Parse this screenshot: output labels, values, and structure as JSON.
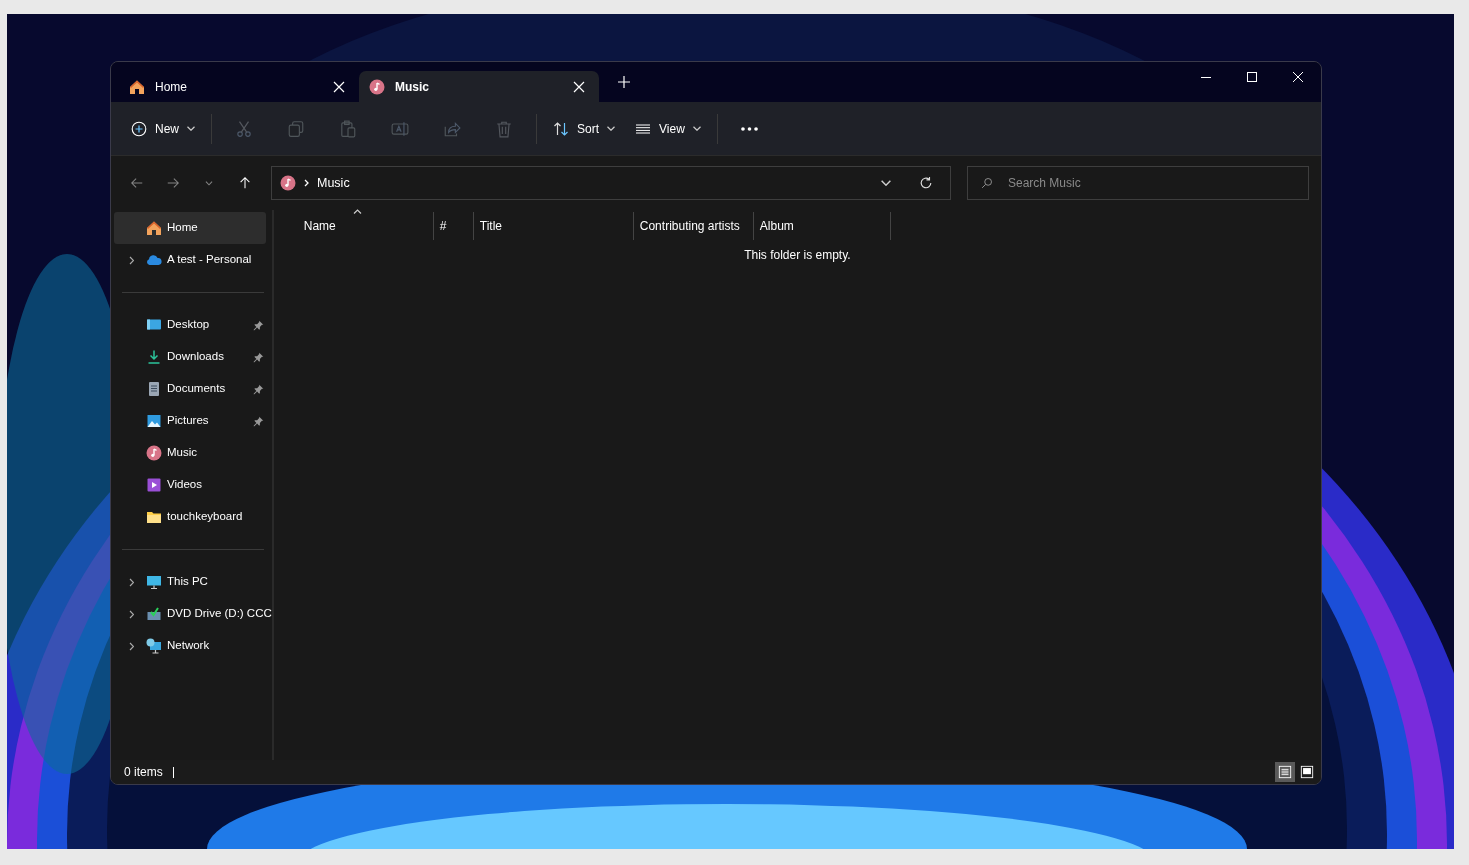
{
  "tabs": [
    {
      "label": "Home",
      "kind": "home",
      "selected": false
    },
    {
      "label": "Music",
      "kind": "music",
      "selected": true
    }
  ],
  "toolbar": [
    {
      "kind": "new",
      "label": "New",
      "disabled": false
    },
    {
      "kind": "sep"
    },
    {
      "kind": "cut",
      "disabled": true
    },
    {
      "kind": "copy",
      "disabled": true
    },
    {
      "kind": "paste",
      "disabled": true
    },
    {
      "kind": "rename",
      "disabled": true
    },
    {
      "kind": "share",
      "disabled": true
    },
    {
      "kind": "delete",
      "disabled": true
    },
    {
      "kind": "sep"
    },
    {
      "kind": "sort",
      "label": "Sort",
      "disabled": false
    },
    {
      "kind": "view",
      "label": "View",
      "disabled": false
    },
    {
      "kind": "sep"
    },
    {
      "kind": "more",
      "disabled": false
    }
  ],
  "address": {
    "kind": "music",
    "path": [
      "Music"
    ]
  },
  "search": {
    "placeholder": "Search Music"
  },
  "sidebar": [
    [
      {
        "label": "Home",
        "kind": "home",
        "expandable": false,
        "pinned": false,
        "selected": true
      },
      {
        "label": "A test - Personal",
        "kind": "cloud",
        "expandable": true,
        "pinned": false,
        "selected": false
      }
    ],
    [
      {
        "label": "Desktop",
        "kind": "desktop",
        "expandable": false,
        "pinned": true,
        "selected": false
      },
      {
        "label": "Downloads",
        "kind": "download",
        "expandable": false,
        "pinned": true,
        "selected": false
      },
      {
        "label": "Documents",
        "kind": "document",
        "expandable": false,
        "pinned": true,
        "selected": false
      },
      {
        "label": "Pictures",
        "kind": "pictures",
        "expandable": false,
        "pinned": true,
        "selected": false
      },
      {
        "label": "Music",
        "kind": "music",
        "expandable": false,
        "pinned": false,
        "selected": false
      },
      {
        "label": "Videos",
        "kind": "videos",
        "expandable": false,
        "pinned": false,
        "selected": false
      },
      {
        "label": "touchkeyboard",
        "kind": "folder",
        "expandable": false,
        "pinned": false,
        "selected": false
      }
    ],
    [
      {
        "label": "This PC",
        "kind": "pc",
        "expandable": true,
        "pinned": false,
        "selected": false
      },
      {
        "label": "DVD Drive (D:) CCC",
        "kind": "dvd",
        "expandable": true,
        "pinned": false,
        "selected": false
      },
      {
        "label": "Network",
        "kind": "network",
        "expandable": true,
        "pinned": false,
        "selected": false
      }
    ]
  ],
  "columns": [
    {
      "label": "Name",
      "sorted": true
    },
    {
      "label": "#",
      "sorted": false
    },
    {
      "label": "Title",
      "sorted": false
    },
    {
      "label": "Contributing artists",
      "sorted": false
    },
    {
      "label": "Album",
      "sorted": false
    }
  ],
  "empty_message": "This folder is empty.",
  "status_bar": {
    "count": "0 items",
    "views": [
      {
        "selected": true
      },
      {
        "selected": false
      }
    ]
  }
}
